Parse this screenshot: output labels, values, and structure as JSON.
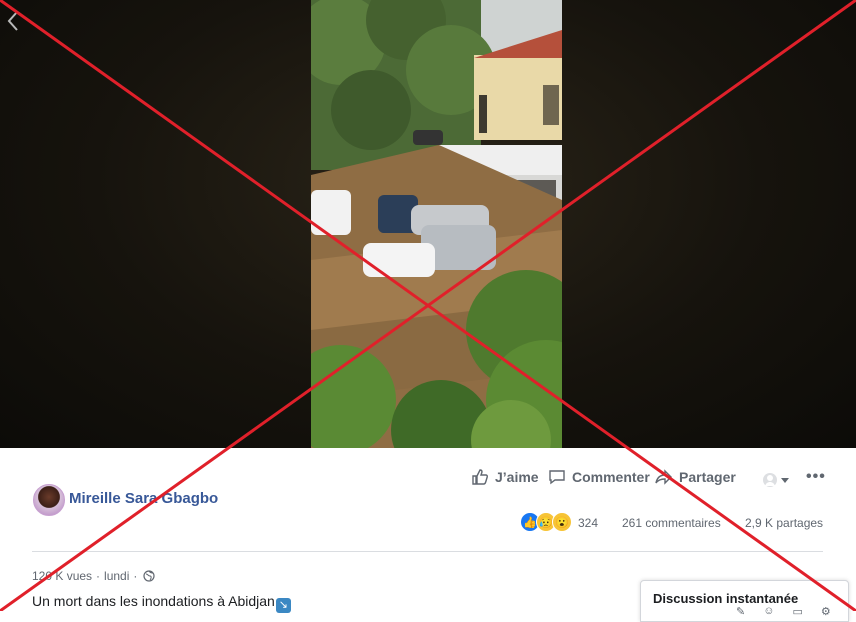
{
  "post": {
    "author": "Mireille Sara Gbagbo",
    "actions": {
      "like": "J’aime",
      "comment": "Commenter",
      "share": "Partager"
    },
    "reactions": {
      "count": "324",
      "types": [
        "like-icon",
        "sad-icon",
        "wow-icon"
      ]
    },
    "comments": "261 commentaires",
    "shares": "2,9 K partages",
    "views": "120 K vues",
    "date": "lundi",
    "separator": "·",
    "caption": "Un mort dans les inondations à Abidjan"
  },
  "chat": {
    "title": "Discussion instantanée"
  },
  "colors": {
    "link": "#385898",
    "cross": "#e0202a",
    "like_blue": "#1877f2"
  }
}
